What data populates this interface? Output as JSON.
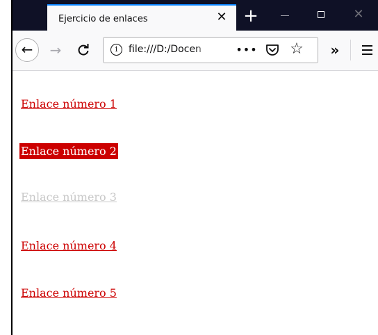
{
  "browser": {
    "tab_title": "Ejercicio de enlaces",
    "tab_close_glyph": "✕",
    "new_tab_glyph": "+",
    "url": "file:///D:/Docen",
    "page_actions_glyph": "•••",
    "overflow_glyph": "»"
  },
  "links": [
    {
      "text": "Enlace número 1",
      "state": "normal"
    },
    {
      "text": "Enlace número 2",
      "state": "hover"
    },
    {
      "text": "Enlace número 3",
      "state": "visited"
    },
    {
      "text": "Enlace número 4",
      "state": "normal"
    },
    {
      "text": "Enlace número 5",
      "state": "normal"
    }
  ],
  "colors": {
    "link": "#cc0000",
    "link_hover_bg": "#cc0000",
    "link_visited": "#c8c8c8",
    "titlebar": "#0f1126",
    "tab_accent": "#0a84ff"
  }
}
